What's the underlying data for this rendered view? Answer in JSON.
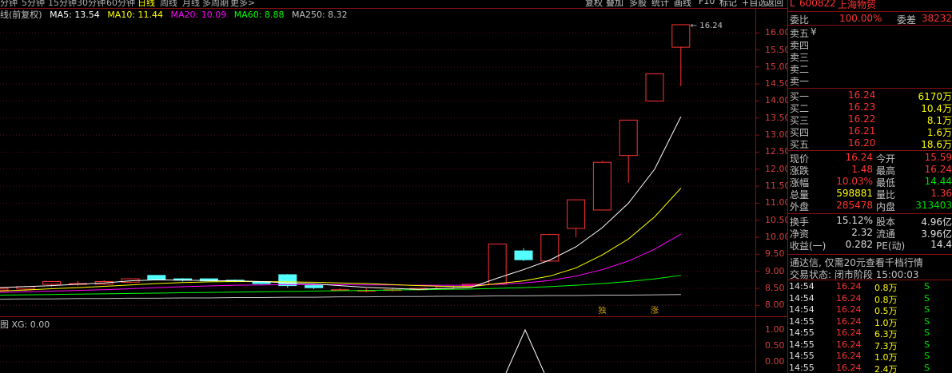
{
  "toolbar": {
    "periods": [
      "分钟",
      "5分钟",
      "15分钟",
      "30分钟",
      "60分钟",
      "日线",
      "周线",
      "月线",
      "多周期",
      "更多>"
    ],
    "active_period": "日线",
    "buttons": [
      "复权",
      "叠加",
      "多股",
      "统计",
      "画线",
      "F10",
      "标记",
      "+自选",
      "返回"
    ]
  },
  "legend": {
    "prefix": "线(前复权)",
    "ma5": "MA5: 13.54",
    "ma10": "MA10: 11.44",
    "ma20": "MA20: 10.09",
    "ma60": "MA60: 8.88",
    "ma250": "MA250: 8.32",
    "colors": {
      "ma5": "#ffffff",
      "ma10": "#ffff00",
      "ma20": "#ff00ff",
      "ma60": "#00ff00",
      "ma250": "#c0c0c0"
    }
  },
  "chart_data": {
    "type": "candlestick",
    "y_ticks": [
      "16.00",
      "15.50",
      "15.00",
      "14.50",
      "14.00",
      "13.50",
      "13.00",
      "12.50",
      "12.00",
      "11.50",
      "11.00",
      "10.50",
      "10.00",
      "9.50",
      "9.00",
      "8.50",
      "8.00"
    ],
    "ylim": [
      7.75,
      16.45
    ],
    "max_label": "16.24",
    "candles": [
      {
        "o": 8.45,
        "h": 8.5,
        "l": 8.4,
        "c": 8.5
      },
      {
        "o": 8.48,
        "h": 8.58,
        "l": 8.42,
        "c": 8.55
      },
      {
        "o": 8.62,
        "h": 8.7,
        "l": 8.55,
        "c": 8.7
      },
      {
        "o": 8.64,
        "h": 8.72,
        "l": 8.58,
        "c": 8.64
      },
      {
        "o": 8.62,
        "h": 8.74,
        "l": 8.6,
        "c": 8.7
      },
      {
        "o": 8.68,
        "h": 8.8,
        "l": 8.65,
        "c": 8.78
      },
      {
        "o": 8.88,
        "h": 8.88,
        "l": 8.75,
        "c": 8.76
      },
      {
        "o": 8.78,
        "h": 8.8,
        "l": 8.7,
        "c": 8.74
      },
      {
        "o": 8.78,
        "h": 8.78,
        "l": 8.72,
        "c": 8.72
      },
      {
        "o": 8.74,
        "h": 8.76,
        "l": 8.68,
        "c": 8.7
      },
      {
        "o": 8.7,
        "h": 8.7,
        "l": 8.62,
        "c": 8.64
      },
      {
        "o": 8.9,
        "h": 8.92,
        "l": 8.52,
        "c": 8.58
      },
      {
        "o": 8.58,
        "h": 8.62,
        "l": 8.48,
        "c": 8.52
      },
      {
        "o": 8.46,
        "h": 8.5,
        "l": 8.42,
        "c": 8.46
      },
      {
        "o": 8.44,
        "h": 8.5,
        "l": 8.38,
        "c": 8.44
      },
      {
        "o": 8.46,
        "h": 8.52,
        "l": 8.4,
        "c": 8.46
      },
      {
        "o": 8.46,
        "h": 8.5,
        "l": 8.44,
        "c": 8.5
      },
      {
        "o": 8.5,
        "h": 8.56,
        "l": 8.46,
        "c": 8.56
      },
      {
        "o": 8.58,
        "h": 8.62,
        "l": 8.54,
        "c": 8.62
      },
      {
        "o": 8.62,
        "h": 9.8,
        "l": 8.6,
        "c": 9.8
      },
      {
        "o": 9.6,
        "h": 9.68,
        "l": 9.3,
        "c": 9.34
      },
      {
        "o": 9.3,
        "h": 10.1,
        "l": 9.28,
        "c": 10.08
      },
      {
        "o": 10.26,
        "h": 11.1,
        "l": 10.0,
        "c": 11.1
      },
      {
        "o": 10.8,
        "h": 12.24,
        "l": 10.8,
        "c": 12.2
      },
      {
        "o": 12.4,
        "h": 13.44,
        "l": 11.6,
        "c": 13.44
      },
      {
        "o": 14.0,
        "h": 14.8,
        "l": 14.0,
        "c": 14.8
      },
      {
        "o": 15.58,
        "h": 16.24,
        "l": 14.44,
        "c": 16.24
      }
    ],
    "ma5": [
      8.52,
      8.55,
      8.58,
      8.62,
      8.66,
      8.72,
      8.75,
      8.74,
      8.73,
      8.72,
      8.7,
      8.66,
      8.63,
      8.58,
      8.53,
      8.5,
      8.47,
      8.5,
      8.53,
      8.8,
      9.05,
      9.33,
      9.72,
      10.28,
      11.0,
      12.0,
      13.54
    ],
    "ma10": [
      8.42,
      8.45,
      8.49,
      8.52,
      8.56,
      8.6,
      8.64,
      8.67,
      8.69,
      8.7,
      8.7,
      8.69,
      8.68,
      8.66,
      8.64,
      8.61,
      8.58,
      8.56,
      8.55,
      8.64,
      8.72,
      8.86,
      9.1,
      9.48,
      9.95,
      10.6,
      11.44
    ],
    "ma20": [
      8.38,
      8.4,
      8.42,
      8.44,
      8.46,
      8.49,
      8.52,
      8.55,
      8.57,
      8.59,
      8.6,
      8.61,
      8.61,
      8.61,
      8.6,
      8.6,
      8.59,
      8.59,
      8.59,
      8.62,
      8.66,
      8.73,
      8.86,
      9.05,
      9.3,
      9.65,
      10.09
    ],
    "ma60": [
      8.3,
      8.31,
      8.32,
      8.33,
      8.34,
      8.35,
      8.36,
      8.37,
      8.38,
      8.39,
      8.4,
      8.41,
      8.42,
      8.43,
      8.44,
      8.45,
      8.46,
      8.47,
      8.48,
      8.5,
      8.52,
      8.55,
      8.59,
      8.64,
      8.7,
      8.78,
      8.88
    ],
    "ma250": [
      8.18,
      8.19,
      8.19,
      8.2,
      8.2,
      8.21,
      8.21,
      8.22,
      8.22,
      8.23,
      8.23,
      8.24,
      8.24,
      8.25,
      8.25,
      8.26,
      8.26,
      8.27,
      8.27,
      8.28,
      8.28,
      8.29,
      8.29,
      8.3,
      8.3,
      8.31,
      8.32
    ],
    "annotations": [
      {
        "text": "独",
        "index": 23
      },
      {
        "text": "涨",
        "index": 25
      }
    ],
    "indicator": {
      "label": "图  XG: 0.00",
      "y_ticks": [
        "1.00",
        "0.50",
        "0.00"
      ],
      "ylim": [
        0,
        1.1
      ],
      "values": [
        0,
        0,
        0,
        0,
        0,
        0,
        0,
        0,
        0,
        0,
        0,
        0,
        0,
        0,
        0,
        0,
        0,
        0,
        0,
        0,
        0,
        0,
        0,
        0,
        0,
        0,
        0
      ],
      "peak_index": 20,
      "peak_value": 1.0
    }
  },
  "panel": {
    "code": "600822",
    "name": "上海物贸",
    "weibi_label": "委比",
    "weibi_value": "100.00%",
    "weicha_label": "委差",
    "weicha_value": "38232",
    "sell": [
      {
        "label": "卖五",
        "price": "¥",
        "vol": ""
      },
      {
        "label": "卖四",
        "price": "",
        "vol": ""
      },
      {
        "label": "卖三",
        "price": "",
        "vol": ""
      },
      {
        "label": "卖二",
        "price": "",
        "vol": ""
      },
      {
        "label": "卖一",
        "price": "",
        "vol": ""
      }
    ],
    "buy": [
      {
        "label": "买一",
        "price": "16.24",
        "vol": "6170万"
      },
      {
        "label": "买二",
        "price": "16.23",
        "vol": "10.4万"
      },
      {
        "label": "买三",
        "price": "16.22",
        "vol": "8.1万"
      },
      {
        "label": "买四",
        "price": "16.21",
        "vol": "1.6万"
      },
      {
        "label": "买五",
        "price": "16.20",
        "vol": "18.6万"
      }
    ],
    "quote": [
      {
        "l1": "现价",
        "v1": "16.24",
        "c1": "red",
        "l2": "今开",
        "v2": "15.59",
        "c2": "red"
      },
      {
        "l1": "涨跌",
        "v1": "1.48",
        "c1": "red",
        "l2": "最高",
        "v2": "16.24",
        "c2": "red"
      },
      {
        "l1": "涨幅",
        "v1": "10.03%",
        "c1": "red",
        "l2": "最低",
        "v2": "14.44",
        "c2": "green"
      },
      {
        "l1": "总量",
        "v1": "598881",
        "c1": "yellow",
        "l2": "量比",
        "v2": "1.36",
        "c2": "red"
      },
      {
        "l1": "外盘",
        "v1": "285478",
        "c1": "red",
        "l2": "内盘",
        "v2": "313403",
        "c2": "green"
      }
    ],
    "fundamentals": [
      {
        "l1": "换手",
        "v1": "15.12%",
        "l2": "股本",
        "v2": "4.96亿"
      },
      {
        "l1": "净资",
        "v1": "2.32",
        "l2": "流通",
        "v2": "3.96亿"
      },
      {
        "l1": "收益(一)",
        "v1": "0.282",
        "l2": "PE(动)",
        "v2": "14.4"
      }
    ],
    "notice": "通达信, 仅需20元查看千档行情",
    "status": "交易状态: 闭市阶段 15:00:03",
    "ticks": [
      {
        "time": "14:54",
        "price": "16.24",
        "vol": "0.8万",
        "side": "S"
      },
      {
        "time": "14:54",
        "price": "16.24",
        "vol": "0.8万",
        "side": "S"
      },
      {
        "time": "14:54",
        "price": "16.24",
        "vol": "0.5万",
        "side": "S"
      },
      {
        "time": "14:55",
        "price": "16.24",
        "vol": "1.0万",
        "side": "S"
      },
      {
        "time": "14:55",
        "price": "16.24",
        "vol": "6.3万",
        "side": "S"
      },
      {
        "time": "14:55",
        "price": "16.24",
        "vol": "7.3万",
        "side": "S"
      },
      {
        "time": "14:55",
        "price": "16.24",
        "vol": "1.0万",
        "side": "S"
      },
      {
        "time": "14:55",
        "price": "16.24",
        "vol": "2.4万",
        "side": "S"
      }
    ]
  }
}
